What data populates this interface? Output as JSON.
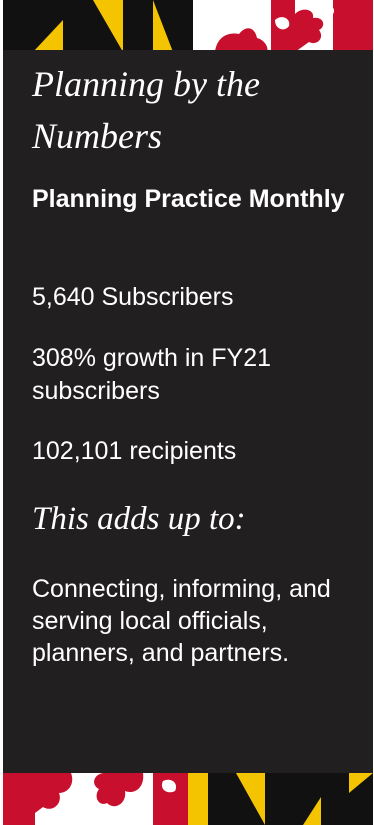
{
  "colors": {
    "panel_background": "#221f20",
    "text": "#ffffff",
    "flag_gold": "#f5c400",
    "flag_black": "#111111",
    "flag_red": "#c8102e",
    "flag_white": "#ffffff"
  },
  "decorations": {
    "top_band": "maryland-flag-banner",
    "bottom_band": "maryland-flag-banner"
  },
  "card": {
    "title": "Planning by the Numbers",
    "subtitle": "Planning Practice Monthly",
    "stats": [
      "5,640 Subscribers",
      "308% growth in FY21 subscribers",
      "102,101 recipients"
    ],
    "adds_up_heading": "This adds up to:",
    "closing": "Connecting, informing, and serving local officials, planners, and partners."
  }
}
